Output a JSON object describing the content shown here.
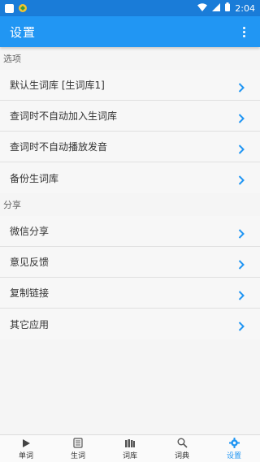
{
  "status_bar": {
    "time": "2:04"
  },
  "app_bar": {
    "title": "设置"
  },
  "sections": [
    {
      "header": "选项",
      "items": [
        {
          "label": "默认生词库 [生词库1]"
        },
        {
          "label": "查词时不自动加入生词库"
        },
        {
          "label": "查词时不自动播放发音"
        },
        {
          "label": "备份生词库"
        }
      ]
    },
    {
      "header": "分享",
      "items": [
        {
          "label": "微信分享"
        },
        {
          "label": "意见反馈"
        },
        {
          "label": "复制链接"
        },
        {
          "label": "其它应用"
        }
      ]
    }
  ],
  "bottom_nav": [
    {
      "label": "单词",
      "icon": "play-icon"
    },
    {
      "label": "生词",
      "icon": "notes-icon"
    },
    {
      "label": "词库",
      "icon": "books-icon"
    },
    {
      "label": "词典",
      "icon": "search-icon"
    },
    {
      "label": "设置",
      "icon": "gear-icon",
      "active": true
    }
  ],
  "colors": {
    "status_bar": "#1a7cd8",
    "app_bar": "#2196f3",
    "accent": "#2196f3",
    "background": "#f5f5f5"
  }
}
